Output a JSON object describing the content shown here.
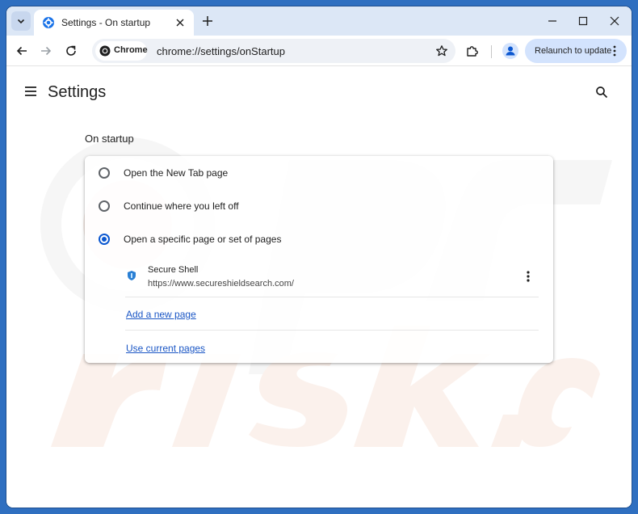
{
  "tab": {
    "title": "Settings - On startup"
  },
  "toolbar": {
    "chip_label": "Chrome",
    "url": "chrome://settings/onStartup",
    "relaunch_label": "Relaunch to update"
  },
  "page": {
    "title": "Settings",
    "section_title": "On startup",
    "options": [
      {
        "label": "Open the New Tab page",
        "checked": false
      },
      {
        "label": "Continue where you left off",
        "checked": false
      },
      {
        "label": "Open a specific page or set of pages",
        "checked": true
      }
    ],
    "startup_page": {
      "name": "Secure Shell",
      "url": "https://www.secureshieldsearch.com/"
    },
    "add_link": "Add a new page",
    "use_current_link": "Use current pages"
  },
  "colors": {
    "accent": "#0b57d0",
    "link": "#1a56c5",
    "frame": "#2f6fc0",
    "tabstrip": "#dce7f6"
  },
  "icons": [
    "tab-search-icon",
    "settings-gear-icon",
    "close-icon",
    "plus-icon",
    "minimize-icon",
    "maximize-icon",
    "back-icon",
    "forward-icon",
    "reload-icon",
    "chrome-logo-icon",
    "star-icon",
    "extensions-icon",
    "profile-icon",
    "more-vert-icon",
    "hamburger-menu-icon",
    "search-icon",
    "shield-icon"
  ]
}
